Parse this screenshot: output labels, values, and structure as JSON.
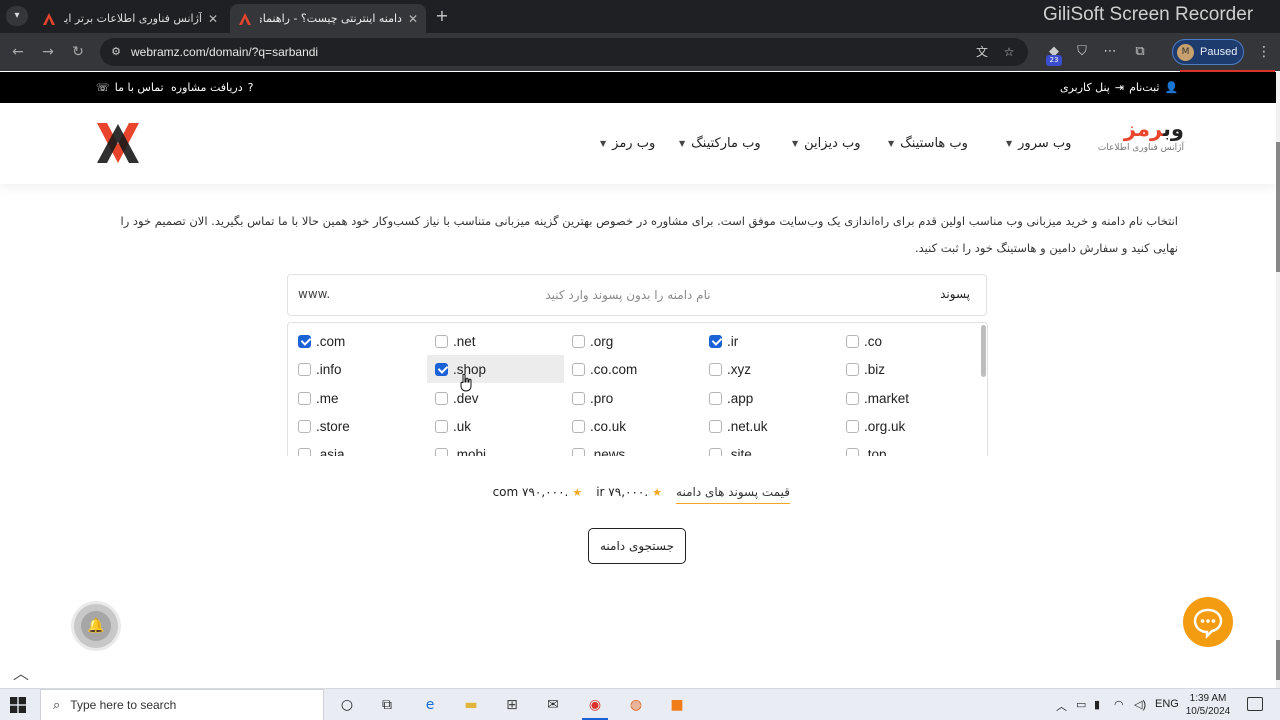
{
  "browser": {
    "tabs": [
      {
        "title": "آژانس فناوری اطلاعات برتر ایران | ..."
      },
      {
        "title": "دامنه اینترنتی چیست؟ - راهنمای ..."
      }
    ],
    "tab_close": "✕",
    "new_tab": "+",
    "url": "webramz.com/domain/?q=sarbandi",
    "profile_initial": "M",
    "profile_status": "Paused",
    "extension_badge": "23",
    "watermark": "GiliSoft Screen Recorder"
  },
  "topbar": {
    "signup": "ثبت‌نام",
    "user_panel": "پنل کاربری",
    "consult": "دریافت مشاوره",
    "contact": "تماس با ما"
  },
  "header": {
    "logo_text_a": "وب",
    "logo_text_b": "رمز",
    "logo_sub": "آژانس فناوری اطلاعات",
    "nav": [
      {
        "label": "وب سرور"
      },
      {
        "label": "وب هاستینگ"
      },
      {
        "label": "وب دیزاین"
      },
      {
        "label": "وب مارکتینگ"
      },
      {
        "label": "وب رمز"
      }
    ]
  },
  "intro": "انتخاب نام دامنه و خرید میزبانی وب مناسب اولین قدم برای راه‌اندازی یک وب‌سایت موفق است. برای مشاوره در خصوص بهترین گزینه میزبانی متناسب با نیاز کسب‌وکار خود همین حالا با ما تماس بگیرید. الان تصمیم خود را نهایی کنید و سفارش دامین و هاستینگ خود را ثبت کنید.",
  "domain_search": {
    "label": "پسوند",
    "placeholder": "نام دامنه را بدون پسوند وارد کنید",
    "value": "",
    "prefix": "www."
  },
  "extensions": [
    [
      {
        "name": ".com",
        "checked": true
      },
      {
        "name": ".net",
        "checked": false
      },
      {
        "name": ".org",
        "checked": false
      },
      {
        "name": ".ir",
        "checked": true
      },
      {
        "name": ".co",
        "checked": false
      }
    ],
    [
      {
        "name": ".info",
        "checked": false
      },
      {
        "name": ".shop",
        "checked": true
      },
      {
        "name": ".co.com",
        "checked": false
      },
      {
        "name": ".xyz",
        "checked": false
      },
      {
        "name": ".biz",
        "checked": false
      }
    ],
    [
      {
        "name": ".me",
        "checked": false
      },
      {
        "name": ".dev",
        "checked": false
      },
      {
        "name": ".pro",
        "checked": false
      },
      {
        "name": ".app",
        "checked": false
      },
      {
        "name": ".market",
        "checked": false
      }
    ],
    [
      {
        "name": ".store",
        "checked": false
      },
      {
        "name": ".uk",
        "checked": false
      },
      {
        "name": ".co.uk",
        "checked": false
      },
      {
        "name": ".net.uk",
        "checked": false
      },
      {
        "name": ".org.uk",
        "checked": false
      }
    ],
    [
      {
        "name": ".asia",
        "checked": false
      },
      {
        "name": ".mobi",
        "checked": false
      },
      {
        "name": ".news",
        "checked": false
      },
      {
        "name": ".site",
        "checked": false
      },
      {
        "name": ".top",
        "checked": false
      }
    ]
  ],
  "prices": {
    "link": "قیمت پسوند های دامنه",
    "ir": ".ir ۷۹,۰۰۰",
    "com": ".com ۷۹۰,۰۰۰"
  },
  "search_button": "جستجوی دامنه",
  "taskbar": {
    "search_placeholder": "Type here to search",
    "lang": "ENG",
    "time": "1:39 AM",
    "date": "10/5/2024"
  },
  "colors": {
    "accent": "#1a62d6",
    "brand_red": "#e8452c",
    "chat_orange": "#f39c12",
    "price_underline": "#f5a623"
  }
}
